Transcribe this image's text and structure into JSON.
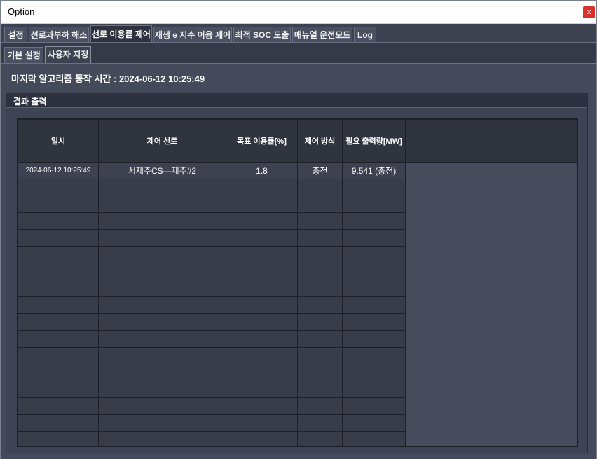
{
  "window": {
    "title": "Option",
    "close_label": "x"
  },
  "tabs": [
    "설정",
    "선로과부하 해소",
    "선로 이용률 제어",
    "재생 e 지수 이용 제어",
    "최적 SOC 도출",
    "매뉴얼 운전모드",
    "Log"
  ],
  "active_tab": "선로 이용률 제어",
  "subtabs": [
    "기본 설정",
    "사용자 지정"
  ],
  "active_subtab": "사용자 지정",
  "last_run": "마지막 알고리즘 동작 시간 : 2024-06-12 10:25:49",
  "group_title": "결과 출력",
  "table": {
    "columns": [
      "일시",
      "제어 선로",
      "목표 이용률[%]",
      "제어 방식",
      "필요 출력량[MW]"
    ],
    "rows": [
      [
        "2024-06-12 10:25:49",
        "서제주CS—제주#2",
        "1.8",
        "충전",
        "9.541 (충전)"
      ]
    ],
    "empty_rows": 16
  }
}
